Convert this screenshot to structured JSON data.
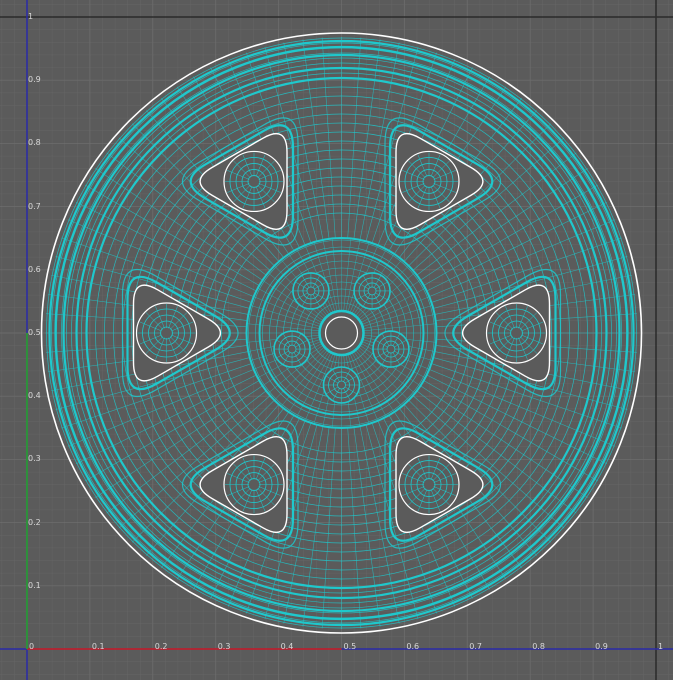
{
  "viewport": {
    "name": "uv-texture-editor",
    "background": "#5b5b5b",
    "grid_color": "#6d6d6d",
    "wire_color": "#1fc8cc",
    "border_color": "#ffffff",
    "axis_u_color": "#d0201c",
    "axis_v_color": "#2aa32a"
  },
  "axes": {
    "u_range": [
      0,
      1
    ],
    "v_range": [
      0,
      1
    ],
    "u_ticks": [
      "0",
      "0.1",
      "0.2",
      "0.3",
      "0.4",
      "0.5",
      "0.6",
      "0.7",
      "0.8",
      "0.9",
      "1"
    ],
    "v_ticks": [
      "0.1",
      "0.2",
      "0.3",
      "0.4",
      "0.5",
      "0.6",
      "0.7",
      "0.8",
      "0.9",
      "1"
    ]
  },
  "uv_shell": {
    "name": "wheel-rim",
    "hub_holes": 5,
    "spoke_windows": 6
  }
}
